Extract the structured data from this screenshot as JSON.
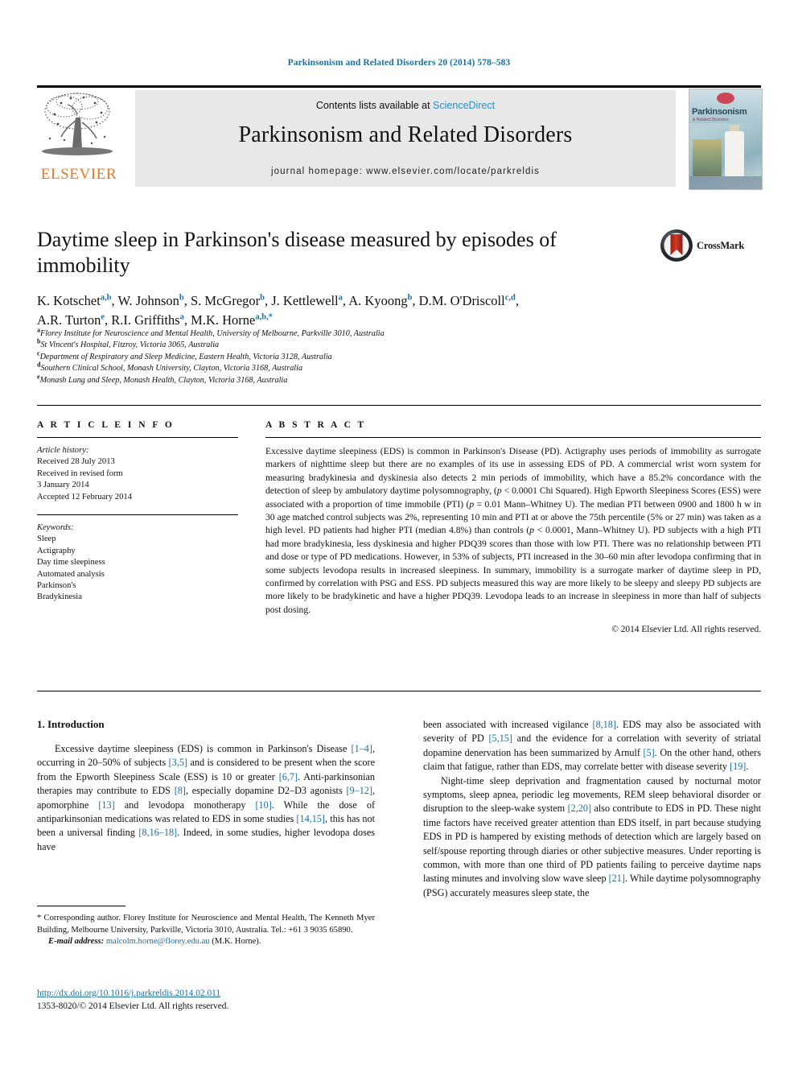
{
  "running_head": "Parkinsonism and Related Disorders 20 (2014) 578–583",
  "masthead": {
    "contents_prefix": "Contents lists available at ",
    "sciencedirect": "ScienceDirect",
    "journal_name": "Parkinsonism and Related Disorders",
    "homepage": "journal homepage: www.elsevier.com/locate/parkreldis",
    "publisher": "ELSEVIER",
    "cover_title": "Parkinsonism",
    "cover_subtitle": "& Related Disorders"
  },
  "crossmark": {
    "label": "CrossMark"
  },
  "article": {
    "title": "Daytime sleep in Parkinson's disease measured by episodes of immobility",
    "authors_line_1_parts": [
      {
        "name": "K. Kotschet",
        "sup": "a,b"
      },
      {
        "name": "W. Johnson",
        "sup": "b"
      },
      {
        "name": "S. McGregor",
        "sup": "b"
      },
      {
        "name": "J. Kettlewell",
        "sup": "a"
      },
      {
        "name": "A. Kyoong",
        "sup": "b"
      },
      {
        "name": "D.M. O'Driscoll",
        "sup": "c,d"
      }
    ],
    "authors_line_2_parts": [
      {
        "name": "A.R. Turton",
        "sup": "e"
      },
      {
        "name": "R.I. Griffiths",
        "sup": "a"
      },
      {
        "name": "M.K. Horne",
        "sup": "a,b,*"
      }
    ],
    "affiliations": [
      {
        "marker": "a",
        "text": "Florey Institute for Neuroscience and Mental Health, University of Melbourne, Parkville 3010, Australia"
      },
      {
        "marker": "b",
        "text": "St Vincent's Hospital, Fitzroy, Victoria 3065, Australia"
      },
      {
        "marker": "c",
        "text": "Department of Respiratory and Sleep Medicine, Eastern Health, Victoria 3128, Australia"
      },
      {
        "marker": "d",
        "text": "Southern Clinical School, Monash University, Clayton, Victoria 3168, Australia"
      },
      {
        "marker": "e",
        "text": "Monash Lung and Sleep, Monash Health, Clayton, Victoria 3168, Australia"
      }
    ]
  },
  "article_info": {
    "heading": "A R T I C L E   I N F O",
    "history_label": "Article history:",
    "history": [
      "Received 28 July 2013",
      "Received in revised form",
      "3 January 2014",
      "Accepted 12 February 2014"
    ],
    "keywords_label": "Keywords:",
    "keywords": [
      "Sleep",
      "Actigraphy",
      "Day time sleepiness",
      "Automated analysis",
      "Parkinson's",
      "Bradykinesia"
    ]
  },
  "abstract": {
    "heading": "A B S T R A C T",
    "paragraph": "Excessive daytime sleepiness (EDS) is common in Parkinson's Disease (PD). Actigraphy uses periods of immobility as surrogate markers of nighttime sleep but there are no examples of its use in assessing EDS of PD. A commercial wrist worn system for measuring bradykinesia and dyskinesia also detects 2 min periods of immobility, which have a 85.2% concordance with the detection of sleep by ambulatory daytime polysomnography, (p < 0.0001 Chi Squared). High Epworth Sleepiness Scores (ESS) were associated with a proportion of time immobile (PTI) (p = 0.01 Mann–Whitney U). The median PTI between 0900 and 1800 h w in 30 age matched control subjects was 2%, representing 10 min and PTI at or above the 75th percentile (5% or 27 min) was taken as a high level. PD patients had higher PTI (median 4.8%) than controls (p < 0.0001, Mann–Whitney U). PD subjects with a high PTI had more bradykinesia, less dyskinesia and higher PDQ39 scores than those with low PTI. There was no relationship between PTI and dose or type of PD medications. However, in 53% of subjects, PTI increased in the 30–60 min after levodopa confirming that in some subjects levodopa results in increased sleepiness. In summary, immobility is a surrogate marker of daytime sleep in PD, confirmed by correlation with PSG and ESS. PD subjects measured this way are more likely to be sleepy and sleepy PD subjects are more likely to be bradykinetic and have a higher PDQ39. Levodopa leads to an increase in sleepiness in more than half of subjects post dosing.",
    "copyright": "© 2014 Elsevier Ltd. All rights reserved."
  },
  "body": {
    "section_heading": "1.  Introduction",
    "left_paragraph_1": "Excessive daytime sleepiness (EDS) is common in Parkinson's Disease [1–4], occurring in 20–50% of subjects [3,5] and is considered to be present when the score from the Epworth Sleepiness Scale (ESS) is 10 or greater [6,7]. Anti-parkinsonian therapies may contribute to EDS [8], especially dopamine D2–D3 agonists [9–12], apomorphine [13] and levodopa monotherapy [10]. While the dose of antiparkinsonian medications was related to EDS in some studies [14,15], this has not been a universal finding [8,16–18]. Indeed, in some studies, higher levodopa doses have",
    "right_paragraph_1": "been associated with increased vigilance [8,18]. EDS may also be associated with severity of PD [5,15] and the evidence for a correlation with severity of striatal dopamine denervation has been summarized by Arnulf [5]. On the other hand, others claim that fatigue, rather than EDS, may correlate better with disease severity [19].",
    "right_paragraph_2": "Night-time sleep deprivation and fragmentation caused by nocturnal motor symptoms, sleep apnea, periodic leg movements, REM sleep behavioral disorder or disruption to the sleep-wake system [2,20] also contribute to EDS in PD. These night time factors have received greater attention than EDS itself, in part because studying EDS in PD is hampered by existing methods of detection which are largely based on self/spouse reporting through diaries or other subjective measures. Under reporting is common, with more than one third of PD patients failing to perceive daytime naps lasting minutes and involving slow wave sleep [21]. While daytime polysomnography (PSG) accurately measures sleep state, the"
  },
  "footnote": {
    "corresponding": "* Corresponding author. Florey Institute for Neuroscience and Mental Health, The Kenneth Myer Building, Melbourne University, Parkville, Victoria 3010, Australia. Tel.: +61 3 9035 65890.",
    "email_label": "E-mail address:",
    "email": "malcolm.horne@florey.edu.au",
    "email_suffix": "(M.K. Horne).",
    "doi": "http://dx.doi.org/10.1016/j.parkreldis.2014.02.011",
    "issn_line": "1353-8020/© 2014 Elsevier Ltd. All rights reserved."
  },
  "colors": {
    "link_blue": "#1a6fa3",
    "elsevier_orange": "#E87722",
    "sciencedirect_blue": "#2a8fc4",
    "band_gray": "#e8e8e8"
  }
}
